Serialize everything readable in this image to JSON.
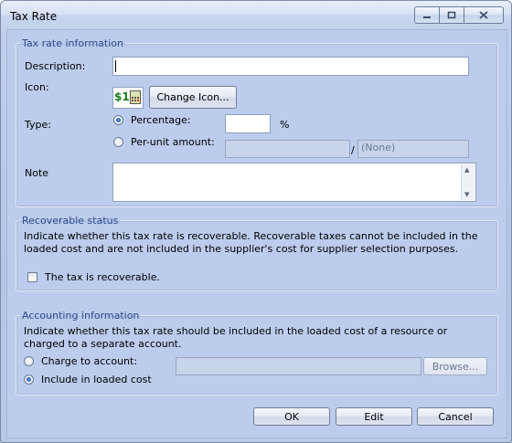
{
  "window": {
    "title": "Tax Rate"
  },
  "tax_rate_information": {
    "legend": "Tax rate information",
    "description_label": "Description:",
    "description_value": "",
    "icon_label": "Icon:",
    "icon_glyph": "$1",
    "change_icon_button": "Change Icon...",
    "type_label": "Type:",
    "percentage_label": "Percentage:",
    "percentage_value": "",
    "percent_sign": "%",
    "per_unit_label": "Per-unit amount:",
    "per_unit_value": "",
    "slash": "/",
    "unit_value": "(None)",
    "note_label": "Note",
    "note_value": "",
    "selected_type": "Percentage"
  },
  "recoverable_status": {
    "legend": "Recoverable status",
    "description": "Indicate whether this tax rate is recoverable.   Recoverable taxes cannot be included in the loaded cost and are not included in the supplier's cost for supplier selection purposes.",
    "checkbox_label": "The  tax is recoverable.",
    "checked": false
  },
  "accounting_information": {
    "legend": "Accounting information",
    "description": "Indicate whether this tax rate should be included in the loaded cost of a resource or charged to a separate account.",
    "charge_label": "Charge to account:",
    "account_value": "",
    "browse_button": "Browse...",
    "include_label": "Include in loaded cost",
    "selected": "Include in loaded cost"
  },
  "footer": {
    "ok": "OK",
    "edit": "Edit",
    "cancel": "Cancel"
  },
  "colors": {
    "accent": "#2b4d8a",
    "panel": "#bcccec"
  }
}
